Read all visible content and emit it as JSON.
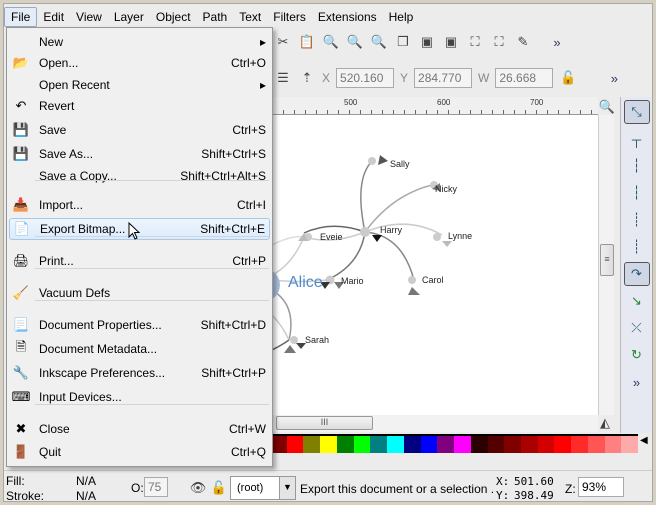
{
  "menubar": [
    "File",
    "Edit",
    "View",
    "Layer",
    "Object",
    "Path",
    "Text",
    "Filters",
    "Extensions",
    "Help"
  ],
  "file_menu": [
    {
      "label": "New",
      "shortcut": "",
      "submenu": true,
      "icon": "none"
    },
    {
      "label": "Open...",
      "shortcut": "Ctrl+O",
      "icon": "folder-icon"
    },
    {
      "label": "Open Recent",
      "shortcut": "",
      "submenu": true,
      "icon": "none"
    },
    {
      "label": "Revert",
      "shortcut": "",
      "icon": "revert-icon"
    },
    {
      "label": "Save",
      "shortcut": "Ctrl+S",
      "icon": "save-icon"
    },
    {
      "label": "Save As...",
      "shortcut": "Shift+Ctrl+S",
      "icon": "save-as-icon"
    },
    {
      "label": "Save a Copy...",
      "shortcut": "Shift+Ctrl+Alt+S",
      "icon": "none"
    },
    {
      "label": "Import...",
      "shortcut": "Ctrl+I",
      "icon": "import-icon"
    },
    {
      "label": "Export Bitmap...",
      "shortcut": "Shift+Ctrl+E",
      "icon": "export-icon",
      "highlighted": true
    },
    {
      "label": "Print...",
      "shortcut": "Ctrl+P",
      "icon": "print-icon"
    },
    {
      "label": "Vacuum Defs",
      "shortcut": "",
      "icon": "vacuum-icon"
    },
    {
      "label": "Document Properties...",
      "shortcut": "Shift+Ctrl+D",
      "icon": "document-properties-icon"
    },
    {
      "label": "Document Metadata...",
      "shortcut": "",
      "icon": "metadata-icon"
    },
    {
      "label": "Inkscape Preferences...",
      "shortcut": "Shift+Ctrl+P",
      "icon": "preferences-icon"
    },
    {
      "label": "Input Devices...",
      "shortcut": "",
      "icon": "input-devices-icon"
    },
    {
      "label": "Close",
      "shortcut": "Ctrl+W",
      "icon": "close-icon"
    },
    {
      "label": "Quit",
      "shortcut": "Ctrl+Q",
      "icon": "quit-icon"
    }
  ],
  "toolbar2": {
    "x_label": "X",
    "x": "520.160",
    "y_label": "Y",
    "y": "284.770",
    "w_label": "W",
    "w": "26.668"
  },
  "ruler": [
    "500",
    "600",
    "700"
  ],
  "nodes": [
    "Sally",
    "Nicky",
    "Harry",
    "Eveie",
    "Lynne",
    "Alice",
    "Mario",
    "Carol",
    "Sarah"
  ],
  "palette": [
    "#800000",
    "#ff0000",
    "#808000",
    "#ffff00",
    "#008000",
    "#00ff00",
    "#008080",
    "#00ffff",
    "#000080",
    "#0000ff",
    "#800080",
    "#ff00ff",
    "#2b0000",
    "#550000",
    "#800000",
    "#aa0000",
    "#d40000",
    "#ff0000",
    "#ff2a2a",
    "#ff5555",
    "#ff8080",
    "#ffaaaa"
  ],
  "status": {
    "fill_label": "Fill:",
    "fill": "N/A",
    "stroke_label": "Stroke:",
    "stroke": "N/A",
    "opacity_label": "O:",
    "opacity": "75",
    "layer": "(root)",
    "message": "Export this document or a selection .",
    "x_label": "X:",
    "x": "501.60",
    "y_label": "Y:",
    "y": "398.49",
    "zoom_label": "Z:",
    "zoom": "93%"
  },
  "accent": "#4f8bc9"
}
